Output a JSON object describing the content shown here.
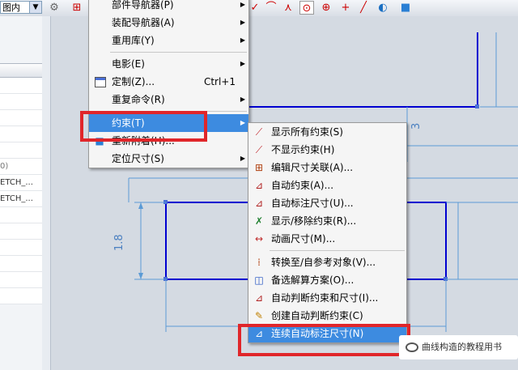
{
  "toolbar": {
    "filter_value": "图内",
    "icons": [
      "view-icon",
      "snap-point-icon",
      "constraint-icon",
      "curve-icon",
      "circle-icon",
      "circle-target-icon",
      "plus-icon",
      "line-icon",
      "shade-icon",
      "cube-icon"
    ]
  },
  "left_panel": {
    "rows": [
      "",
      "",
      "",
      "",
      "",
      "",
      "",
      "",
      "",
      "",
      "0)",
      "ETCH_...",
      "ETCH_...",
      "",
      "",
      "",
      "",
      "",
      ""
    ]
  },
  "main_menu": {
    "items": [
      {
        "label": "部件导航器(P)",
        "has_sub": true
      },
      {
        "label": "装配导航器(A)",
        "has_sub": true
      },
      {
        "label": "重用库(Y)",
        "has_sub": true
      },
      {
        "label": "电影(E)",
        "has_sub": true
      },
      {
        "label": "定制(Z)...",
        "accel": "Ctrl+1",
        "icon": "customize-icon"
      },
      {
        "label": "重复命令(R)",
        "has_sub": true
      },
      {
        "label": "约束(T)",
        "has_sub": true,
        "selected": true
      },
      {
        "label": "重新附着(H)...",
        "icon": "reattach-icon"
      },
      {
        "label": "定位尺寸(S)",
        "has_sub": true
      }
    ]
  },
  "sub_menu": {
    "items": [
      {
        "label": "显示所有约束(S)",
        "icon": "show-all-constraints-icon"
      },
      {
        "label": "不显示约束(H)",
        "icon": "hide-constraints-icon"
      },
      {
        "label": "编辑尺寸关联(A)...",
        "icon": "edit-dimension-association-icon"
      },
      {
        "label": "自动约束(A)...",
        "icon": "auto-constrain-icon"
      },
      {
        "label": "自动标注尺寸(U)...",
        "icon": "auto-dimension-icon"
      },
      {
        "label": "显示/移除约束(R)...",
        "icon": "show-remove-constraints-icon"
      },
      {
        "label": "动画尺寸(M)...",
        "icon": "animate-dimension-icon"
      },
      {
        "label": "转换至/自参考对象(V)...",
        "icon": "convert-reference-icon"
      },
      {
        "label": "备选解算方案(O)...",
        "icon": "alternate-solution-icon"
      },
      {
        "label": "自动判断约束和尺寸(I)...",
        "icon": "infer-constraints-dimensions-icon"
      },
      {
        "label": "创建自动判断约束(C)",
        "icon": "create-inferred-constraints-icon"
      },
      {
        "label": "连续自动标注尺寸(N)",
        "icon": "continuous-auto-dimension-icon",
        "selected": true
      }
    ]
  },
  "canvas": {
    "dim_labels": [
      "1.8",
      "3"
    ]
  },
  "watermark": {
    "text": "曲线构造的教程用书"
  },
  "colors": {
    "sketch_line": "#0000d0",
    "dimension_line": "#5b9bd5",
    "highlight": "#e0262a",
    "menu_selection": "#3d8be0"
  }
}
